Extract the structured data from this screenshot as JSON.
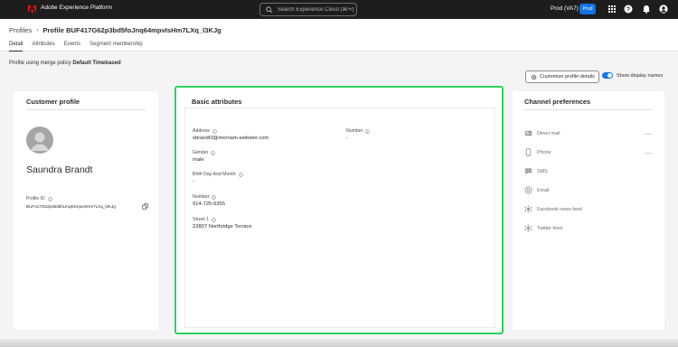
{
  "topbar": {
    "app_title": "Adobe Experience Platform",
    "search_placeholder": "Search Experience Cloud (⌘+/)",
    "sandbox": "Prod (VA7)",
    "env_badge": "Prod",
    "icons": [
      "adobe-logo-icon",
      "search-icon",
      "apps-grid-icon",
      "help-icon",
      "bell-icon",
      "user-avatar-icon"
    ]
  },
  "breadcrumb": {
    "parent": "Profiles",
    "separator": "›",
    "current": "Profile BUF417G62p3bd5foJnq64mpvIsHm7LXq_l3KJg"
  },
  "tabs": [
    "Detail",
    "Attributes",
    "Events",
    "Segment membership"
  ],
  "merge_policy": {
    "prefix": "Profile using merge policy",
    "name": "Default Timebased"
  },
  "actions": {
    "customize_label": "Customize profile details",
    "show_display_names_label": "Show display names",
    "show_display_names_on": true
  },
  "customer_profile": {
    "title": "Customer profile",
    "name": "Saundra Brandt",
    "profile_id_label": "Profile ID",
    "profile_id_value": "BUF417G62p3bd5foJnq64mpvIsHm7LXq_l3KJg"
  },
  "basic_attributes": {
    "title": "Basic attributes",
    "address_label": "Address",
    "address_value": "sbrandt3@merriam-webster.com",
    "number_label_right": "Number",
    "number_value_right": "-",
    "gender_label": "Gender",
    "gender_value": "male",
    "birthday_label": "Birth Day And Month",
    "birthday_value": "-",
    "number_label": "Number",
    "number_value": "914-725-6355",
    "street_label": "Street 1",
    "street_value": "22807 Northridge Terrace"
  },
  "channel_preferences": {
    "title": "Channel preferences",
    "items": [
      {
        "label": "Direct mail",
        "icon": "direct-mail-icon"
      },
      {
        "label": "Phone",
        "icon": "phone-icon"
      },
      {
        "label": "SMS",
        "icon": "sms-icon"
      },
      {
        "label": "Email",
        "icon": "email-icon"
      },
      {
        "label": "Facebook news feed",
        "icon": "facebook-feed-icon"
      },
      {
        "label": "Twitter feed",
        "icon": "twitter-feed-icon"
      }
    ]
  },
  "colors": {
    "topbar": "#1d1d1d",
    "accent_blue": "#1473e6",
    "highlight_green": "#2dd35c"
  }
}
